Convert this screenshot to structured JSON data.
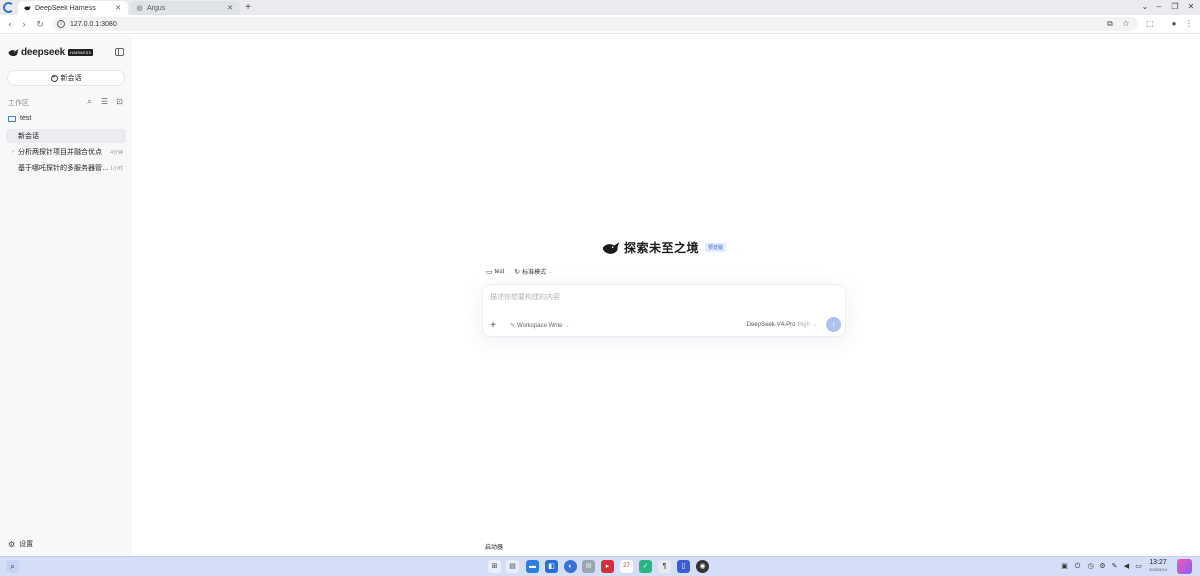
{
  "browser": {
    "tabs": [
      {
        "title": "DeepSeek Harness",
        "active": true
      },
      {
        "title": "Argus",
        "active": false
      }
    ],
    "new_tab": "+",
    "url": "127.0.0.1:3080"
  },
  "sidebar": {
    "brand": "deepseek",
    "brand_badge": "HARNESS",
    "new_chat_label": "新会话",
    "workspace_label": "工作区",
    "folder": "test",
    "chats": [
      {
        "title": "新会话",
        "time": "",
        "selected": true
      },
      {
        "title": "分析两探针项目并融合优点",
        "time": "4分钟",
        "selected": false
      },
      {
        "title": "基于哪吒探针的多服务器管…",
        "time": "1小时",
        "selected": false
      }
    ],
    "settings_label": "设置"
  },
  "main": {
    "heading": "探索未至之境",
    "badge": "预览版",
    "context": {
      "folder": "test",
      "mode": "标准模式"
    },
    "composer": {
      "placeholder": "描述你想要构建的内容",
      "mode": "Workspace Write",
      "model": "DeepSeek-V4-Pro",
      "level": "High"
    },
    "launcher_label": "启动器"
  },
  "taskbar": {
    "time": "13:27",
    "date": "2026/5/14"
  },
  "colors": {
    "accent": "#3b6fd8",
    "send_button": "#aec2ec",
    "taskbar": "#d4def7"
  }
}
